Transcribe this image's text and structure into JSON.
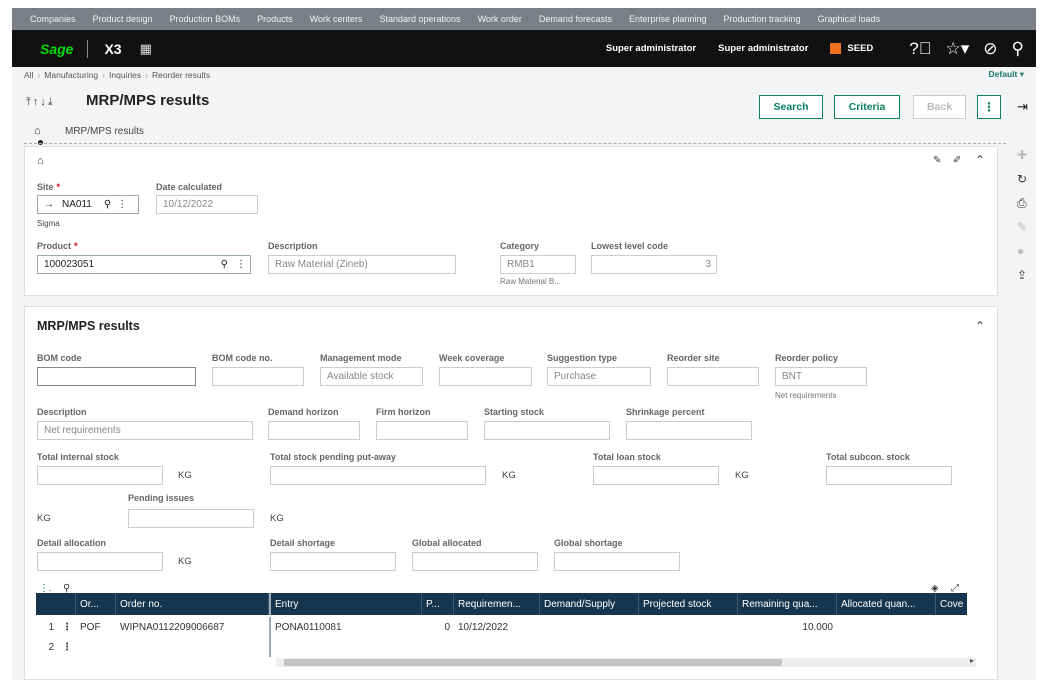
{
  "topnav": [
    "Companies",
    "Product design",
    "Production BOMs",
    "Products",
    "Work centers",
    "Standard operations",
    "Work order",
    "Demand forecasts",
    "Enterprise planning",
    "Production tracking",
    "Graphical loads"
  ],
  "brand": {
    "logo": "Sage",
    "app": "X3"
  },
  "header": {
    "user1": "Super administrator",
    "user2": "Super administrator",
    "folder": "SEED"
  },
  "breadcrumb": [
    "All",
    "Manufacturing",
    "Inquiries",
    "Reorder results"
  ],
  "default_label": "Default",
  "page": {
    "title": "MRP/MPS results",
    "tab_label": "MRP/MPS results"
  },
  "buttons": {
    "search": "Search",
    "criteria": "Criteria",
    "back": "Back"
  },
  "criteria": {
    "site_label": "Site",
    "site_value": "NA011",
    "site_desc": "Sigma",
    "date_label": "Date calculated",
    "date_value": "10/12/2022",
    "product_label": "Product",
    "product_value": "100023051",
    "description_label": "Description",
    "description_value": "Raw Material (Zineb)",
    "category_label": "Category",
    "category_value": "RMB1",
    "category_desc": "Raw Material B...",
    "lowest_label": "Lowest level code",
    "lowest_value": "3"
  },
  "results": {
    "title": "MRP/MPS results",
    "bom_code_label": "BOM code",
    "bom_code_value": "",
    "bom_no_label": "BOM code no.",
    "bom_no_value": "",
    "mgmt_label": "Management mode",
    "mgmt_value": "Available stock",
    "week_label": "Week coverage",
    "week_value": "",
    "sugg_label": "Suggestion type",
    "sugg_value": "Purchase",
    "reorder_site_label": "Reorder site",
    "reorder_site_value": "",
    "policy_label": "Reorder policy",
    "policy_value": "BNT",
    "policy_desc": "Net requirements",
    "desc_label": "Description",
    "desc_value": "Net requirements",
    "demand_label": "Demand horizon",
    "firm_label": "Firm horizon",
    "starting_label": "Starting stock",
    "shrink_label": "Shrinkage percent",
    "tis_label": "Total internal stock",
    "tspp_label": "Total stock pending put-away",
    "tls_label": "Total loan stock",
    "tss_label": "Total subcon. stock",
    "pending_label": "Pending issues",
    "da_label": "Detail allocation",
    "ds_label": "Detail shortage",
    "ga_label": "Global allocated",
    "gs_label": "Global shortage",
    "unit": "KG"
  },
  "table": {
    "columns": [
      "Or...",
      "Order no.",
      "Entry",
      "P...",
      "Requiremen...",
      "Demand/Supply",
      "Projected stock",
      "Remaining qua...",
      "Allocated quan...",
      "Cove"
    ],
    "rows": [
      {
        "num": "1",
        "or": "POF",
        "order": "WIPNA0112209006687",
        "entry": "PONA0110081",
        "p": "0",
        "req": "10/12/2022",
        "ds": "",
        "ps": "",
        "rem": "10.000",
        "alloc": "",
        "cov": ""
      },
      {
        "num": "2",
        "or": "",
        "order": "",
        "entry": "",
        "p": "",
        "req": "",
        "ds": "",
        "ps": "",
        "rem": "",
        "alloc": "",
        "cov": ""
      }
    ]
  }
}
